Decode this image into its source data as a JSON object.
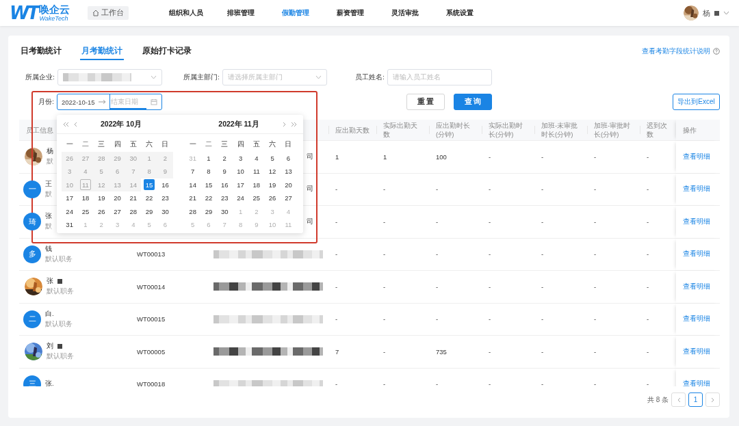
{
  "header": {
    "logo": {
      "mark": "WT",
      "name": "唤企云",
      "tagline": "WakeTech"
    },
    "workbench": "工作台",
    "nav": [
      {
        "label": "组织和人员",
        "selected": false
      },
      {
        "label": "排班管理",
        "selected": false
      },
      {
        "label": "假勤管理",
        "selected": true
      },
      {
        "label": "薪资管理",
        "selected": false
      },
      {
        "label": "灵活审批",
        "selected": false
      },
      {
        "label": "系统设置",
        "selected": false
      }
    ],
    "user": {
      "name": "杨",
      "redacted": true
    }
  },
  "tabs": [
    {
      "label": "日考勤统计",
      "selected": false
    },
    {
      "label": "月考勤统计",
      "selected": true
    },
    {
      "label": "原始打卡记录",
      "selected": false
    }
  ],
  "help_link": "查看考勤字段统计说明",
  "filters": {
    "company": {
      "label": "所属企业:",
      "redacted": true
    },
    "department": {
      "label": "所属主部门:",
      "placeholder": "请选择所属主部门"
    },
    "employee": {
      "label": "员工姓名:",
      "placeholder": "请输入员工姓名"
    },
    "month": {
      "label": "月份:",
      "start": "2022-10-15",
      "end_placeholder": "结束日期"
    }
  },
  "buttons": {
    "reset": "重 置",
    "search": "查 询",
    "export": "导出到Excel"
  },
  "table": {
    "columns": [
      {
        "label": "员工信息"
      },
      {},
      {},
      {
        "label": "应出勤天数"
      },
      {
        "label": "实际出勤天数"
      },
      {
        "label": "应出勤时长(分钟)"
      },
      {
        "label": "实际出勤时长(分钟)"
      },
      {
        "label": "加班-未审批时长(分钟)"
      },
      {
        "label": "加班-审批时长(分钟)"
      },
      {
        "label": "迟到次数"
      },
      {
        "label": "操作"
      }
    ],
    "rows": [
      {
        "avatar": {
          "kind": "picture"
        },
        "name": "杨",
        "name_redacted": false,
        "role": "默",
        "company": "司",
        "company_redacted": false,
        "values": [
          "1",
          "1",
          "100",
          "-",
          "-",
          "-",
          "-"
        ],
        "action": "查看明细"
      },
      {
        "avatar": {
          "kind": "letter",
          "text": "一"
        },
        "name": "王",
        "name_redacted": false,
        "role": "默",
        "company": "司",
        "company_redacted": false,
        "values": [
          "-",
          "-",
          "-",
          "-",
          "-",
          "-",
          "-"
        ],
        "action": "查看明细"
      },
      {
        "avatar": {
          "kind": "letter",
          "text": "琦"
        },
        "name": "张",
        "name_redacted": false,
        "role": "默",
        "company": "司",
        "company_redacted": false,
        "values": [
          "-",
          "-",
          "-",
          "-",
          "-",
          "-",
          "-"
        ],
        "action": "查看明细"
      },
      {
        "avatar": {
          "kind": "letter",
          "text": "多"
        },
        "name": "钱",
        "name_redacted": false,
        "role": "默认职务",
        "emp_id": "WT00013",
        "company_redacted": true,
        "values": [
          "-",
          "-",
          "-",
          "-",
          "-",
          "-",
          "-"
        ],
        "action": "查看明细"
      },
      {
        "avatar": {
          "kind": "picture"
        },
        "name": "张",
        "name_redacted": true,
        "role": "默认职务",
        "emp_id": "WT00014",
        "company_redacted": true,
        "values": [
          "-",
          "-",
          "-",
          "-",
          "-",
          "-",
          "-"
        ],
        "action": "查看明细"
      },
      {
        "avatar": {
          "kind": "letter",
          "text": "二"
        },
        "name": "白.",
        "name_redacted": false,
        "role": "默认职务",
        "emp_id": "WT00015",
        "company_redacted": true,
        "values": [
          "-",
          "-",
          "-",
          "-",
          "-",
          "-",
          "-"
        ],
        "action": "查看明细"
      },
      {
        "avatar": {
          "kind": "picture"
        },
        "name": "刘",
        "name_redacted": true,
        "role": "默认职务",
        "emp_id": "WT00005",
        "company_redacted": true,
        "values": [
          "7",
          "-",
          "735",
          "-",
          "-",
          "-",
          "-"
        ],
        "action": "查看明细"
      },
      {
        "avatar": {
          "kind": "letter",
          "text": "三"
        },
        "name": "张.",
        "name_redacted": false,
        "emp_id": "WT00018",
        "company_redacted": true,
        "values": [
          "-",
          "-",
          "-",
          "-",
          "-",
          "-",
          "-"
        ],
        "action": "查看明细"
      }
    ]
  },
  "date_popup": {
    "months": [
      {
        "title": "2022年 10月",
        "weekdays": [
          "一",
          "二",
          "三",
          "四",
          "五",
          "六",
          "日"
        ],
        "weeks": [
          [
            {
              "text": "26",
              "kind": "disabled",
              "selected": false
            },
            {
              "text": "27",
              "kind": "disabled",
              "selected": false
            },
            {
              "text": "28",
              "kind": "disabled",
              "selected": false
            },
            {
              "text": "29",
              "kind": "disabled",
              "selected": false
            },
            {
              "text": "30",
              "kind": "disabled",
              "selected": false
            },
            {
              "text": "1",
              "kind": "disabled",
              "selected": false
            },
            {
              "text": "2",
              "kind": "disabled",
              "selected": false
            }
          ],
          [
            {
              "text": "3",
              "kind": "disabled",
              "selected": false
            },
            {
              "text": "4",
              "kind": "disabled",
              "selected": false
            },
            {
              "text": "5",
              "kind": "disabled",
              "selected": false
            },
            {
              "text": "6",
              "kind": "disabled",
              "selected": false
            },
            {
              "text": "7",
              "kind": "disabled",
              "selected": false
            },
            {
              "text": "8",
              "kind": "disabled",
              "selected": false
            },
            {
              "text": "9",
              "kind": "disabled",
              "selected": false
            }
          ],
          [
            {
              "text": "10",
              "kind": "disabled",
              "selected": false
            },
            {
              "text": "11",
              "kind": "disabled-today",
              "selected": false
            },
            {
              "text": "12",
              "kind": "disabled",
              "selected": false
            },
            {
              "text": "13",
              "kind": "disabled",
              "selected": false
            },
            {
              "text": "14",
              "kind": "disabled",
              "selected": false
            },
            {
              "text": "15",
              "kind": "day",
              "selected": true
            },
            {
              "text": "16",
              "kind": "day",
              "selected": false
            }
          ],
          [
            {
              "text": "17",
              "kind": "day",
              "selected": false
            },
            {
              "text": "18",
              "kind": "day",
              "selected": false
            },
            {
              "text": "19",
              "kind": "day",
              "selected": false
            },
            {
              "text": "20",
              "kind": "day",
              "selected": false
            },
            {
              "text": "21",
              "kind": "day",
              "selected": false
            },
            {
              "text": "22",
              "kind": "day",
              "selected": false
            },
            {
              "text": "23",
              "kind": "day",
              "selected": false
            }
          ],
          [
            {
              "text": "24",
              "kind": "day",
              "selected": false
            },
            {
              "text": "25",
              "kind": "day",
              "selected": false
            },
            {
              "text": "26",
              "kind": "day",
              "selected": false
            },
            {
              "text": "27",
              "kind": "day",
              "selected": false
            },
            {
              "text": "28",
              "kind": "day",
              "selected": false
            },
            {
              "text": "29",
              "kind": "day",
              "selected": false
            },
            {
              "text": "30",
              "kind": "day",
              "selected": false
            }
          ],
          [
            {
              "text": "31",
              "kind": "day",
              "selected": false
            },
            {
              "text": "1",
              "kind": "out",
              "selected": false
            },
            {
              "text": "2",
              "kind": "out",
              "selected": false
            },
            {
              "text": "3",
              "kind": "out",
              "selected": false
            },
            {
              "text": "4",
              "kind": "out",
              "selected": false
            },
            {
              "text": "5",
              "kind": "out",
              "selected": false
            },
            {
              "text": "6",
              "kind": "out",
              "selected": false
            }
          ]
        ]
      },
      {
        "title": "2022年 11月",
        "weekdays": [
          "一",
          "二",
          "三",
          "四",
          "五",
          "六",
          "日"
        ],
        "weeks": [
          [
            {
              "text": "31",
              "kind": "out",
              "selected": false
            },
            {
              "text": "1",
              "kind": "day",
              "selected": false
            },
            {
              "text": "2",
              "kind": "day",
              "selected": false
            },
            {
              "text": "3",
              "kind": "day",
              "selected": false
            },
            {
              "text": "4",
              "kind": "day",
              "selected": false
            },
            {
              "text": "5",
              "kind": "day",
              "selected": false
            },
            {
              "text": "6",
              "kind": "day",
              "selected": false
            }
          ],
          [
            {
              "text": "7",
              "kind": "day",
              "selected": false
            },
            {
              "text": "8",
              "kind": "day",
              "selected": false
            },
            {
              "text": "9",
              "kind": "day",
              "selected": false
            },
            {
              "text": "10",
              "kind": "day",
              "selected": false
            },
            {
              "text": "11",
              "kind": "day",
              "selected": false
            },
            {
              "text": "12",
              "kind": "day",
              "selected": false
            },
            {
              "text": "13",
              "kind": "day",
              "selected": false
            }
          ],
          [
            {
              "text": "14",
              "kind": "day",
              "selected": false
            },
            {
              "text": "15",
              "kind": "day",
              "selected": false
            },
            {
              "text": "16",
              "kind": "day",
              "selected": false
            },
            {
              "text": "17",
              "kind": "day",
              "selected": false
            },
            {
              "text": "18",
              "kind": "day",
              "selected": false
            },
            {
              "text": "19",
              "kind": "day",
              "selected": false
            },
            {
              "text": "20",
              "kind": "day",
              "selected": false
            }
          ],
          [
            {
              "text": "21",
              "kind": "day",
              "selected": false
            },
            {
              "text": "22",
              "kind": "day",
              "selected": false
            },
            {
              "text": "23",
              "kind": "day",
              "selected": false
            },
            {
              "text": "24",
              "kind": "day",
              "selected": false
            },
            {
              "text": "25",
              "kind": "day",
              "selected": false
            },
            {
              "text": "26",
              "kind": "day",
              "selected": false
            },
            {
              "text": "27",
              "kind": "day",
              "selected": false
            }
          ],
          [
            {
              "text": "28",
              "kind": "day",
              "selected": false
            },
            {
              "text": "29",
              "kind": "day",
              "selected": false
            },
            {
              "text": "30",
              "kind": "day",
              "selected": false
            },
            {
              "text": "1",
              "kind": "out",
              "selected": false
            },
            {
              "text": "2",
              "kind": "out",
              "selected": false
            },
            {
              "text": "3",
              "kind": "out",
              "selected": false
            },
            {
              "text": "4",
              "kind": "out",
              "selected": false
            }
          ],
          [
            {
              "text": "5",
              "kind": "out",
              "selected": false
            },
            {
              "text": "6",
              "kind": "out",
              "selected": false
            },
            {
              "text": "7",
              "kind": "out",
              "selected": false
            },
            {
              "text": "8",
              "kind": "out",
              "selected": false
            },
            {
              "text": "9",
              "kind": "out",
              "selected": false
            },
            {
              "text": "10",
              "kind": "out",
              "selected": false
            },
            {
              "text": "11",
              "kind": "out",
              "selected": false
            }
          ]
        ]
      }
    ]
  },
  "pagination": {
    "total": "共 8 条",
    "pages": [
      {
        "label": "1",
        "selected": true
      }
    ]
  }
}
